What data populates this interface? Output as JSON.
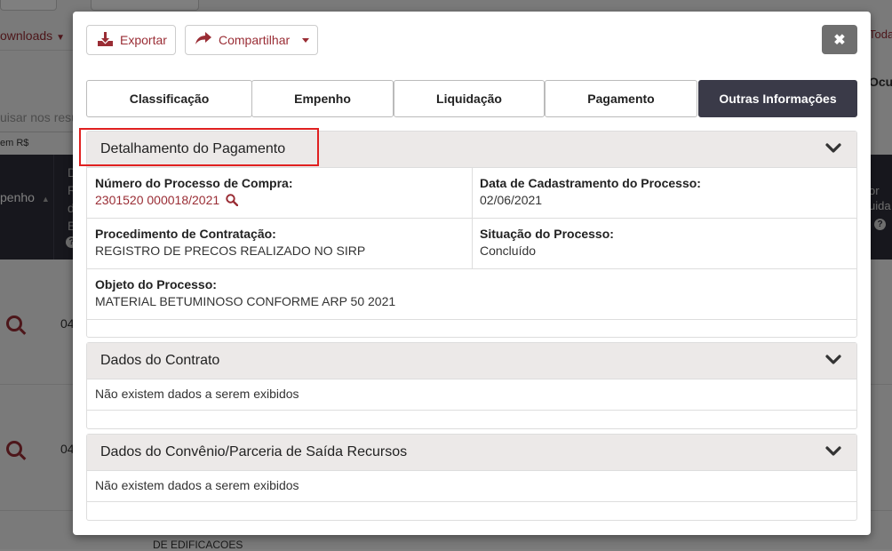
{
  "background": {
    "downloads_label": "ownloads",
    "search_placeholder": "uisar nos resu",
    "currency_note": "em R$",
    "col_empenho": "penho",
    "col_d_lines": [
      "D",
      "R",
      "d",
      "E"
    ],
    "row_values": [
      "04",
      "04"
    ],
    "right_todas": "Toda",
    "right_ocultar": "Ocul",
    "right_valor": [
      "or",
      "uida"
    ],
    "bottom_text": "DE EDIFICACOES"
  },
  "toolbar": {
    "export_label": "Exportar",
    "share_label": "Compartilhar",
    "close_icon": "close-icon"
  },
  "tabs": [
    {
      "label": "Classificação",
      "active": false
    },
    {
      "label": "Empenho",
      "active": false
    },
    {
      "label": "Liquidação",
      "active": false
    },
    {
      "label": "Pagamento",
      "active": false
    },
    {
      "label": "Outras Informações",
      "active": true
    }
  ],
  "panels": {
    "pagamento": {
      "title": "Detalhamento do Pagamento",
      "numero_label": "Número do Processo de Compra:",
      "numero_value": "2301520 000018/2021",
      "data_label": "Data de Cadastramento do Processo:",
      "data_value": "02/06/2021",
      "procedimento_label": "Procedimento de Contratação:",
      "procedimento_value": "REGISTRO DE PRECOS REALIZADO NO SIRP",
      "situacao_label": "Situação do Processo:",
      "situacao_value": "Concluído",
      "objeto_label": "Objeto do Processo:",
      "objeto_value": "MATERIAL BETUMINOSO CONFORME ARP 50 2021"
    },
    "contrato": {
      "title": "Dados do Contrato",
      "empty": "Não existem dados a serem exibidos"
    },
    "convenio": {
      "title": "Dados do Convênio/Parceria de Saída Recursos",
      "empty": "Não existem dados a serem exibidos"
    }
  },
  "colors": {
    "accent": "#9a2d35",
    "active_tab": "#3a3a48",
    "highlight": "#e02020"
  }
}
